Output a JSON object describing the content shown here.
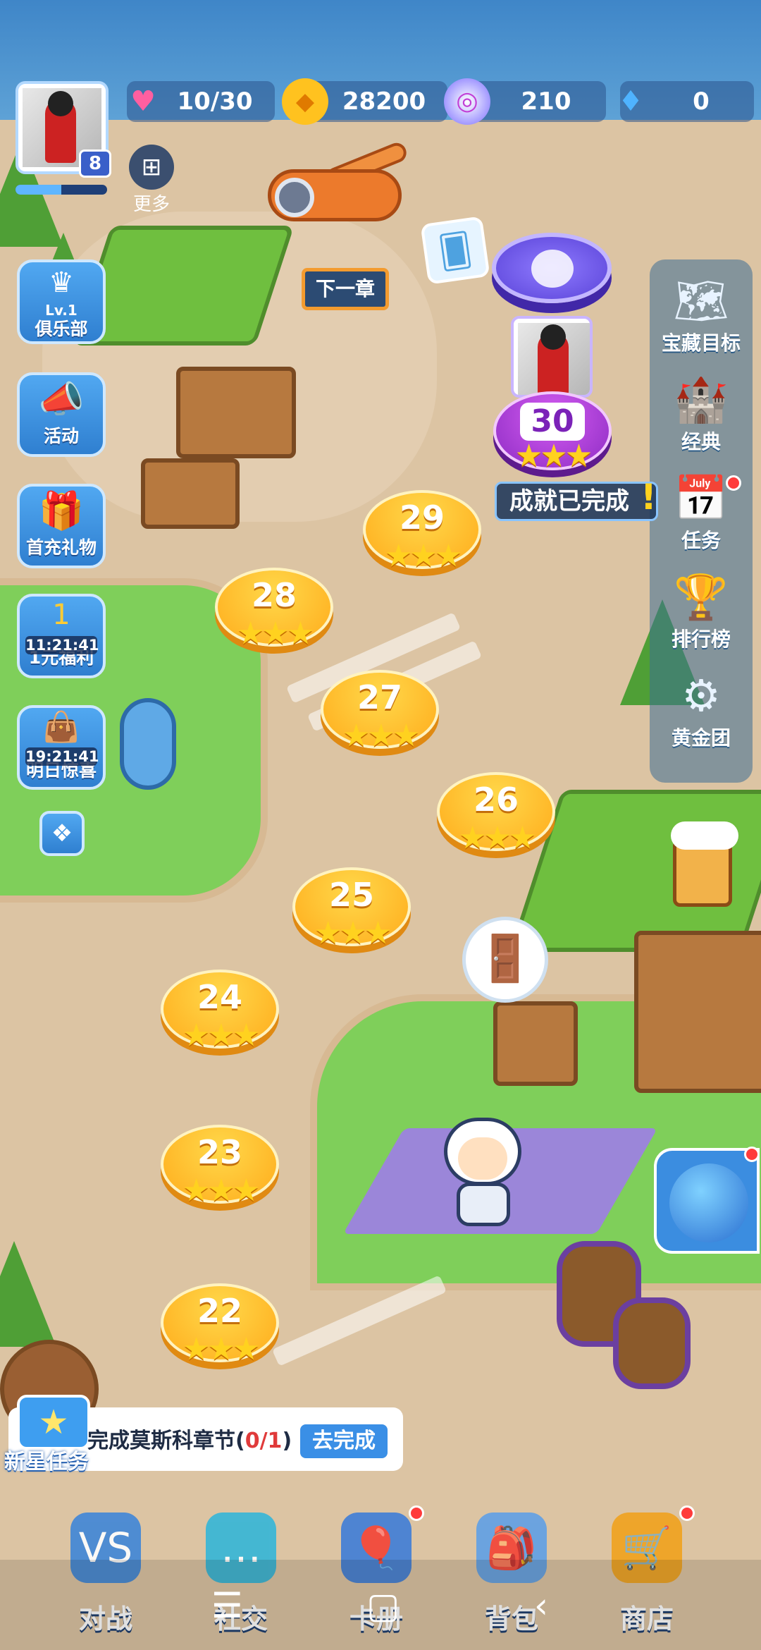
{
  "status_bar": {
    "lives": "10/30",
    "coins": "28200",
    "energy": "210",
    "diamonds": "0",
    "icons": {
      "lives": "heart-icon",
      "coins": "coin-icon",
      "energy": "swirl-energy-icon",
      "diamonds": "diamond-icon"
    }
  },
  "player": {
    "level": "8",
    "exp_fraction": 0.5,
    "more_label": "更多"
  },
  "left_menu": {
    "club": {
      "badge": "Lv.1",
      "label": "俱乐部"
    },
    "events": {
      "label": "活动"
    },
    "first_recharge": {
      "label": "首充礼物"
    },
    "one_yuan": {
      "badge": "1",
      "timer": "11:21:41",
      "label": "1元福利"
    },
    "tomorrow": {
      "timer": "19:21:41",
      "label": "明日惊喜"
    }
  },
  "right_menu": {
    "treasure": "宝藏目标",
    "classic": "经典",
    "tasks": "任务",
    "leaderboard": "排行榜",
    "gold_team": "黄金团"
  },
  "map": {
    "next_chapter": "下一章",
    "achievement": "成就已完成",
    "current_level": "30",
    "levels": [
      {
        "num": "29",
        "stars": "★★★"
      },
      {
        "num": "28",
        "stars": "★★★"
      },
      {
        "num": "27",
        "stars": "★★★"
      },
      {
        "num": "26",
        "stars": "★★★"
      },
      {
        "num": "25",
        "stars": "★★★"
      },
      {
        "num": "24",
        "stars": "★★★"
      },
      {
        "num": "23",
        "stars": "★★★"
      },
      {
        "num": "22",
        "stars": "★★★"
      }
    ],
    "current_stars": "★★★"
  },
  "quest": {
    "tag": "新星任务",
    "text_before": "完成莫斯科章节(",
    "progress": "0/1",
    "text_after": ")",
    "button": "去完成"
  },
  "bottom_nav": [
    {
      "label": "对战",
      "icon": "vs-icon"
    },
    {
      "label": "社交",
      "icon": "chat-icon"
    },
    {
      "label": "卡册",
      "icon": "card-album-icon"
    },
    {
      "label": "背包",
      "icon": "backpack-icon"
    },
    {
      "label": "商店",
      "icon": "shop-cart-icon"
    }
  ],
  "colors": {
    "level_gold": "#ffb11f",
    "current_purple": "#9b35d1",
    "panel_blue": "#2f7fd0"
  }
}
